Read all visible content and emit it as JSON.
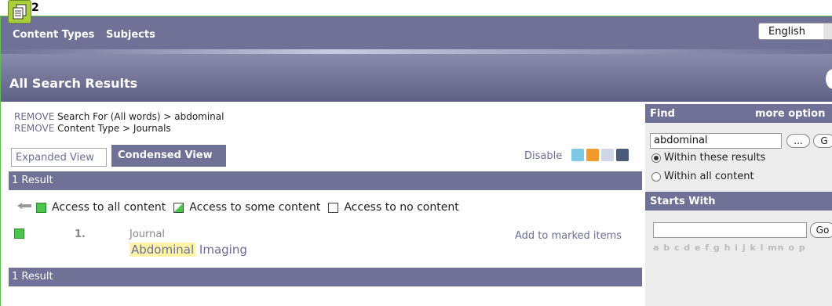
{
  "badge": {
    "count": "2",
    "icon": "documents-icon"
  },
  "nav": {
    "items": [
      {
        "label": "Content Types"
      },
      {
        "label": "Subjects"
      }
    ],
    "language": "English"
  },
  "banner": {
    "title": "All Search Results"
  },
  "crumbs": [
    {
      "remove": "REMOVE",
      "text": "Search For (All words) > abdominal"
    },
    {
      "remove": "REMOVE",
      "text": "Content Type > Journals"
    }
  ],
  "views": {
    "expanded": "Expanded View",
    "condensed": "Condensed View"
  },
  "disable": "Disable",
  "results": {
    "count_label": "1 Result"
  },
  "legend": {
    "all": "Access to all content",
    "some": "Access to some content",
    "none": "Access to no content"
  },
  "items": [
    {
      "number": "1.",
      "type": "Journal",
      "title_highlight": "Abdominal",
      "title_rest": "Imaging",
      "action": "Add to marked items"
    }
  ],
  "find": {
    "header": "Find",
    "more": "more option",
    "query": "abdominal",
    "ellipsis": "...",
    "go_partial": "G",
    "options": [
      {
        "label": "Within these results",
        "selected": true
      },
      {
        "label": "Within all content",
        "selected": false
      }
    ]
  },
  "starts_with": {
    "header": "Starts With",
    "go": "Go",
    "alphabet": "a b c d e f g h i j k l mn o p"
  },
  "colors": {
    "nav_bg": "#6f7196",
    "green": "#4cc34a",
    "highlight": "#fff3a6",
    "link": "#6a6f99"
  }
}
